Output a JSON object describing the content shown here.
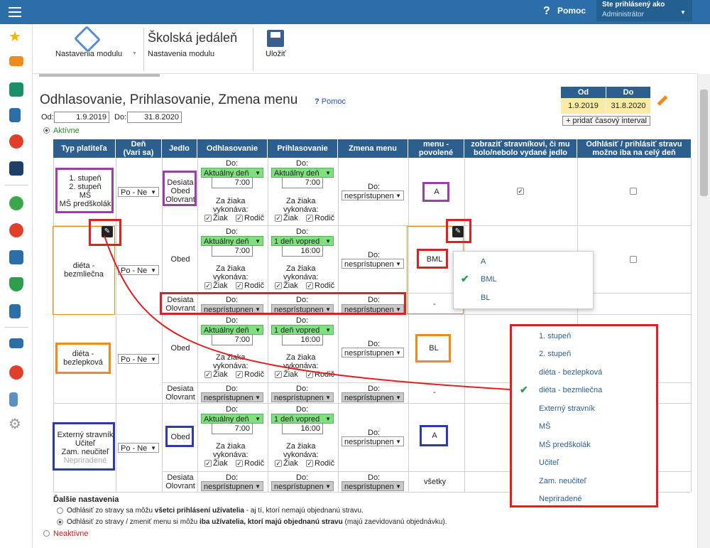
{
  "topbar": {
    "help": "Pomoc",
    "logged_as": "Ste prihlásený ako",
    "user": "Administrátor"
  },
  "toolbar": {
    "module_settings": "Nastavenia modulu",
    "app_title": "Školská jedáleň",
    "app_subtitle": "Nastavenia modulu",
    "save": "Uložiť"
  },
  "page": {
    "title": "Odhlasovanie, Prihlasovanie, Zmena menu",
    "help": "Pomoc",
    "from_label": "Od:",
    "from_value": "1.9.2019",
    "to_label": "Do:",
    "to_value": "31.8.2020",
    "active": "Aktívne",
    "inactive": "Neaktívne"
  },
  "interval": {
    "od_header": "Od",
    "do_header": "Do",
    "od_value": "1.9.2019",
    "do_value": "31.8.2020",
    "add_button": "+ pridať časový interval"
  },
  "table_headers": [
    "Typ platiteľa",
    "Deň\n(Vari sa)",
    "Jedlo",
    "Odhlasovanie",
    "Prihlasovanie",
    "Zmena menu",
    "menu -\npovolené",
    "zobraziť stravníkovi, či mu\nbolo/nebolo vydané jedlo",
    "Odhlásiť / prihlásiť stravu\nmožno iba na celý deň"
  ],
  "labels": {
    "do": "Do:",
    "za_ziaka": "Za žiaka\nvykonáva:",
    "ziak": "Žiak",
    "rodic": "Rodič",
    "aktualny_den": "Aktuálny deň",
    "jeden_den_vopred": "1 deň vopred",
    "nepristupnen": "nesprístupnen",
    "po_ne": "Po - Ne",
    "time_700": "7:00",
    "time_1600": "16:00",
    "dash": "-",
    "vsetky": "všetky"
  },
  "rows": [
    {
      "payer": "1. stupeň\n2. stupeň\nMŠ\nMŠ predškolák",
      "meal": "Desiata\nObed\nOlovrant",
      "menu": "A"
    },
    {
      "payer": "diéta -\nbezmliečna",
      "meal": "Obed",
      "meal2": "Desiata\nOlovrant",
      "menu": "BML"
    },
    {
      "payer": "diéta -\nbezlepková",
      "meal": "Obed",
      "meal2": "Desiata\nOlovrant",
      "menu": "BL"
    },
    {
      "payer": "Externý stravník\nUčiteľ\nZam. neučiteľ",
      "payer_gray": "Nepriradené",
      "meal": "Obed",
      "meal2": "Desiata\nOlovrant",
      "menu": "A"
    }
  ],
  "menu_dropdown": [
    "A",
    "BML",
    "BL"
  ],
  "payer_dropdown": [
    "1. stupeň",
    "2. stupeň",
    "diéta - bezlepková",
    "diéta - bezmliečna",
    "Externý stravník",
    "MŠ",
    "MŠ predškolák",
    "Učiteľ",
    "Zam. neučiteľ",
    "Nepriradené"
  ],
  "further": {
    "title": "Ďalšie nastavenia",
    "opt1_a": "Odhlásiť zo stravy sa môžu ",
    "opt1_b": "všetci prihlásení užívatelia",
    "opt1_c": " - aj tí, ktorí nemajú objednanú stravu.",
    "opt2_a": "Odhlásiť zo stravy / zmeniť menu si môžu ",
    "opt2_b": "iba užívatelia, ktorí majú objednanú stravu",
    "opt2_c": " (majú zaevidovanú objednávku)."
  },
  "colors": {
    "header_blue": "#2c5f8d",
    "topbar_blue": "#2b6ea8",
    "purple": "#9b3fa8",
    "red": "#e02020",
    "orange": "#f08a1c",
    "navy": "#2c3ab0",
    "green": "#7ee07e"
  }
}
